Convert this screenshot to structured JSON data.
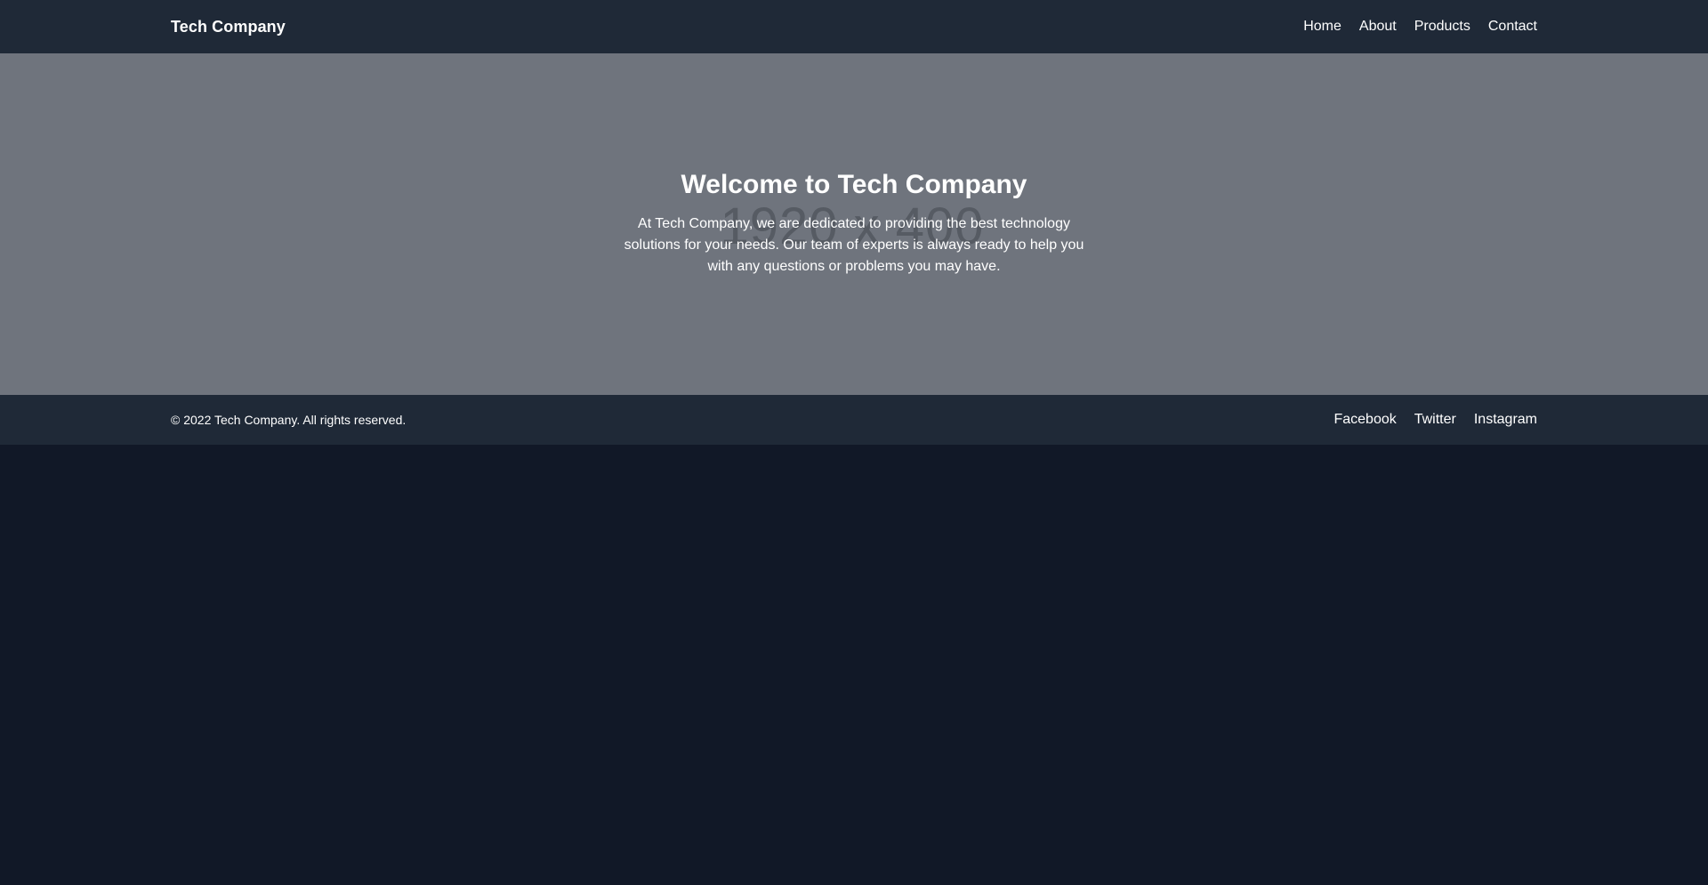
{
  "header": {
    "brand": "Tech Company",
    "nav": [
      "Home",
      "About",
      "Products",
      "Contact"
    ]
  },
  "hero": {
    "placeholder": "1920 x 400",
    "title": "Welcome to Tech Company",
    "text": "At Tech Company, we are dedicated to providing the best technology solutions for your needs. Our team of experts is always ready to help you with any questions or problems you may have."
  },
  "footer": {
    "copyright": "© 2022 Tech Company. All rights reserved.",
    "social": [
      "Facebook",
      "Twitter",
      "Instagram"
    ]
  },
  "colors": {
    "page_background": "#111827",
    "header_background": "#1f2937",
    "hero_background": "#6f747d",
    "text": "#ffffff"
  }
}
